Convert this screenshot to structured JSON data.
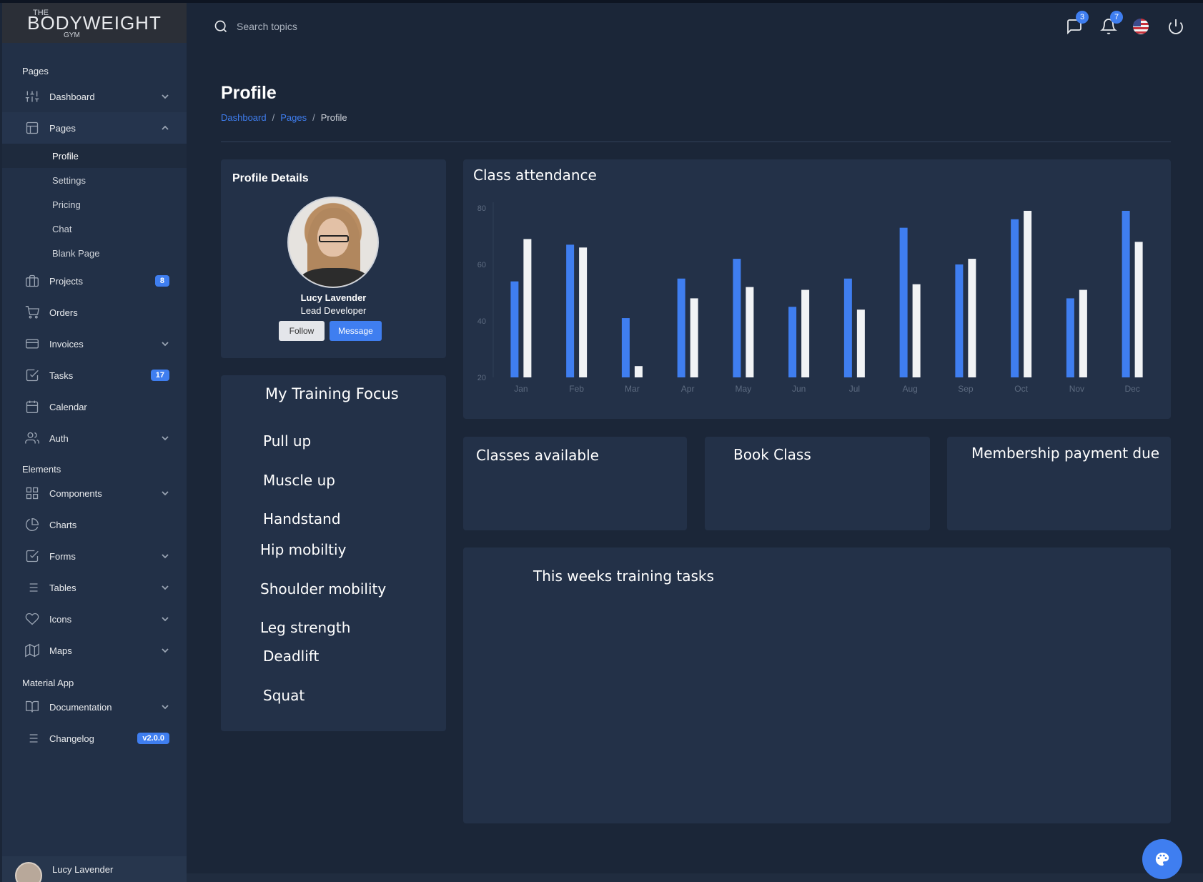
{
  "brand": {
    "the": "THE",
    "main": "BODYWEIGHT",
    "gym": "GYM"
  },
  "search": {
    "placeholder": "Search topics"
  },
  "topbar": {
    "messages_count": "3",
    "notifications_count": "7"
  },
  "sidebar": {
    "sections": {
      "pages": "Pages",
      "elements": "Elements",
      "material": "Material App"
    },
    "items": {
      "dashboard": "Dashboard",
      "pages": "Pages",
      "profile": "Profile",
      "settings": "Settings",
      "pricing": "Pricing",
      "chat": "Chat",
      "blank": "Blank Page",
      "projects": "Projects",
      "projects_badge": "8",
      "orders": "Orders",
      "invoices": "Invoices",
      "tasks": "Tasks",
      "tasks_badge": "17",
      "calendar": "Calendar",
      "auth": "Auth",
      "components": "Components",
      "charts": "Charts",
      "forms": "Forms",
      "tables": "Tables",
      "icons": "Icons",
      "maps": "Maps",
      "documentation": "Documentation",
      "changelog": "Changelog",
      "changelog_badge": "v2.0.0"
    },
    "user_name": "Lucy Lavender"
  },
  "page": {
    "title": "Profile",
    "breadcrumb": [
      "Dashboard",
      "Pages",
      "Profile"
    ]
  },
  "profile": {
    "card_title": "Profile Details",
    "name": "Lucy Lavender",
    "role": "Lead Developer",
    "follow": "Follow",
    "message": "Message"
  },
  "chart_data": {
    "type": "bar",
    "title": "Class attendance",
    "categories": [
      "Jan",
      "Feb",
      "Mar",
      "Apr",
      "May",
      "Jun",
      "Jul",
      "Aug",
      "Sep",
      "Oct",
      "Nov",
      "Dec"
    ],
    "series": [
      {
        "color": "#3f7ef0",
        "values": [
          54,
          67,
          41,
          55,
          62,
          45,
          55,
          73,
          60,
          76,
          48,
          79
        ]
      },
      {
        "color": "#f1f3f5",
        "values": [
          69,
          66,
          24,
          48,
          52,
          51,
          44,
          53,
          62,
          79,
          51,
          68
        ]
      }
    ],
    "yticks": [
      20,
      40,
      60,
      80
    ],
    "ylim": [
      20,
      80
    ]
  },
  "focus": {
    "title": "My Training Focus",
    "items": [
      "Pull up",
      "Muscle up",
      "Handstand",
      "Hip mobiltiy",
      "Shoulder mobility",
      "Leg strength",
      "Deadlift",
      "Squat"
    ]
  },
  "cards": {
    "classes_available": "Classes available",
    "book_class": "Book Class",
    "membership": "Membership payment due"
  },
  "tasks": {
    "title": "This weeks training tasks"
  }
}
